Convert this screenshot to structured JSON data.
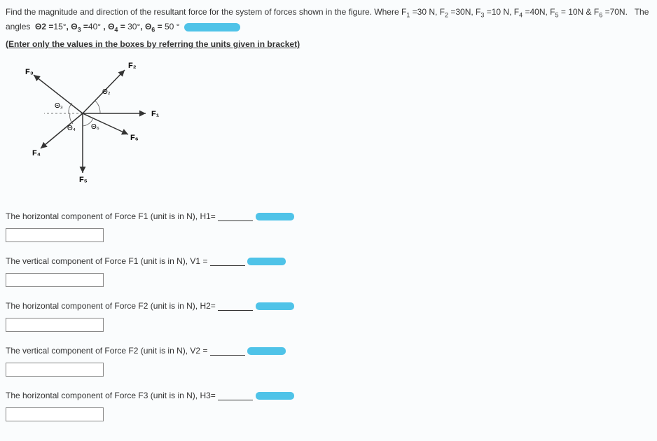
{
  "problem": {
    "line1_prefix": "Find the magnitude and direction of the resultant force for the system of forces shown in the figure. Where F",
    "forces_text": " =30 N, F₂ =30N, F₃ =10 N, F₄ =40N, F₅ = 10N & F₆ =70N.   The angles  Θ2 =15°, Θ₃ =40° , Θ₄ = 30°, Θ₆ = 50 °",
    "f1_val": "30 N",
    "f2_val": "30N",
    "f3_val": "10 N",
    "f4_val": "40N",
    "f5_val": "10N",
    "f6_val": "70N",
    "theta2": "15°",
    "theta3": "40°",
    "theta4": "30°",
    "theta6": "50 °",
    "instruction": "(Enter only the values in the boxes by referring the units given in bracket)"
  },
  "figure": {
    "labels": {
      "F1": "F₁",
      "F2": "F₂",
      "F3": "F₃",
      "F4": "F₄",
      "F5": "F₅",
      "F6": "F₆",
      "t2": "Θ₂",
      "t3": "Θ₃",
      "t4": "Θ₄",
      "t6": "Θ₆"
    }
  },
  "questions": {
    "q1": "The horizontal component of Force F1 (unit is in N), H1=",
    "q2": "The vertical component of Force F1 (unit is in N), V1 =",
    "q3": "The horizontal component of Force F2 (unit is in N), H2=",
    "q4": "The vertical component of Force F2 (unit is in N), V2 =",
    "q5": "The horizontal component of Force F3 (unit is in N), H3="
  }
}
